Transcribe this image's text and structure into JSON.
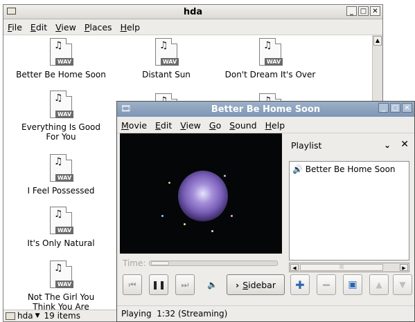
{
  "file_manager": {
    "title": "hda",
    "menu": [
      "File",
      "Edit",
      "View",
      "Places",
      "Help"
    ],
    "files": [
      {
        "name": "Better Be Home Soon"
      },
      {
        "name": "Distant Sun"
      },
      {
        "name": "Don't Dream It's Over"
      },
      {
        "name": "Everything Is Good For You"
      },
      {
        "name": "I Feel Possessed"
      },
      {
        "name": "It's Only Natural"
      },
      {
        "name": "Not The Girl You Think You Are"
      }
    ],
    "file_badge": "WAV",
    "status": {
      "folder": "hda",
      "items": "19 items"
    }
  },
  "player": {
    "title": "Better Be Home Soon",
    "menu": [
      "Movie",
      "Edit",
      "View",
      "Go",
      "Sound",
      "Help"
    ],
    "time_label": "Time:",
    "sidebar_button": "Sidebar",
    "playlist": {
      "title": "Playlist",
      "items": [
        "Better Be Home Soon"
      ]
    },
    "status": "Playing  1:32 (Streaming)",
    "progress_fraction": 0.02
  },
  "colors": {
    "player_titlebar": "#8aa0bd",
    "playlist_add": "#2d66b0",
    "playlist_save": "#2d66b0"
  },
  "icons": [
    "folder-icon",
    "music-file-icon",
    "speaker-icon",
    "plus-icon",
    "minus-icon",
    "save-icon",
    "up-icon",
    "down-icon"
  ]
}
